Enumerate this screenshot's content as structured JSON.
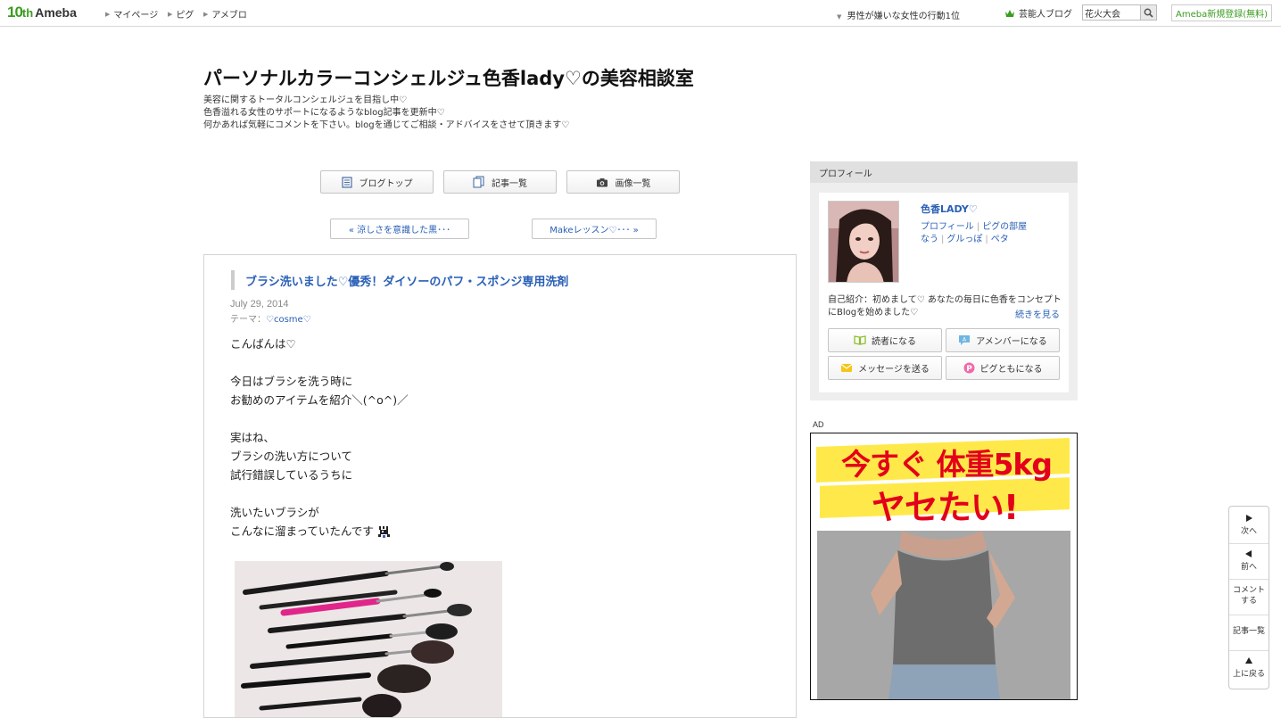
{
  "topbar": {
    "logo_ten": "10",
    "logo_th": "th",
    "logo_name": "Ameba",
    "nav": [
      "マイページ",
      "ピグ",
      "アメブロ"
    ],
    "trend_text": "男性が嫌いな女性の行動1位",
    "celeb_label": "芸能人ブログ",
    "search_value": "花火大会",
    "register_label": "Ameba新規登録(無料)",
    "brand_color": "#3c9b22"
  },
  "blog": {
    "title": "パーソナルカラーコンシェルジュ色香lady♡の美容相談室",
    "description": [
      "美容に関するトータルコンシェルジュを目指し中♡",
      "色香溢れる女性のサポートになるようなblog記事を更新中♡",
      "何かあれば気軽にコメントを下さい。blogを通じてご相談・アドバイスをさせて頂きます♡"
    ]
  },
  "nav_buttons": {
    "top": "ブログトップ",
    "list": "記事一覧",
    "images": "画像一覧"
  },
  "pager": {
    "prev": "« 涼しさを意識した黒･･･",
    "next": "Makeレッスン♡･･･ »"
  },
  "article": {
    "title": "ブラシ洗いました♡優秀！ダイソーのパフ・スポンジ専用洗剤",
    "date": "July 29, 2014",
    "theme_label": "テーマ：",
    "theme_value": "♡cosme♡",
    "body": [
      "こんばんは♡",
      "",
      "今日はブラシを洗う時に",
      "お勧めのアイテムを紹介＼(^o^)／",
      "",
      "実はね、",
      "ブラシの洗い方について",
      "試行錯誤しているうちに",
      "",
      "洗いたいブラシが",
      "こんなに溜まっていたんです"
    ]
  },
  "profile": {
    "header": "プロフィール",
    "name": "色香LADY♡",
    "links_row1": [
      "プロフィール",
      "ピグの部屋"
    ],
    "links_row2": [
      "なう",
      "グルっぽ",
      "ペタ"
    ],
    "intro": "自己紹介：初めまして♡ あなたの毎日に色香をコンセプトにBlogを始めました♡",
    "read_more": "続きを見る",
    "buttons": {
      "reader": "読者になる",
      "member": "アメンバーになる",
      "message": "メッセージを送る",
      "pigg": "ピグともになる"
    }
  },
  "ad": {
    "label": "AD",
    "line1": "今すぐ 体重5kg",
    "line2": "ヤセたい!",
    "text_color": "#e3001b",
    "band_color": "#ffe94a"
  },
  "rail": {
    "next": "次へ",
    "prev": "前へ",
    "comment_1": "コメント",
    "comment_2": "する",
    "list": "記事一覧",
    "top": "上に戻る"
  }
}
